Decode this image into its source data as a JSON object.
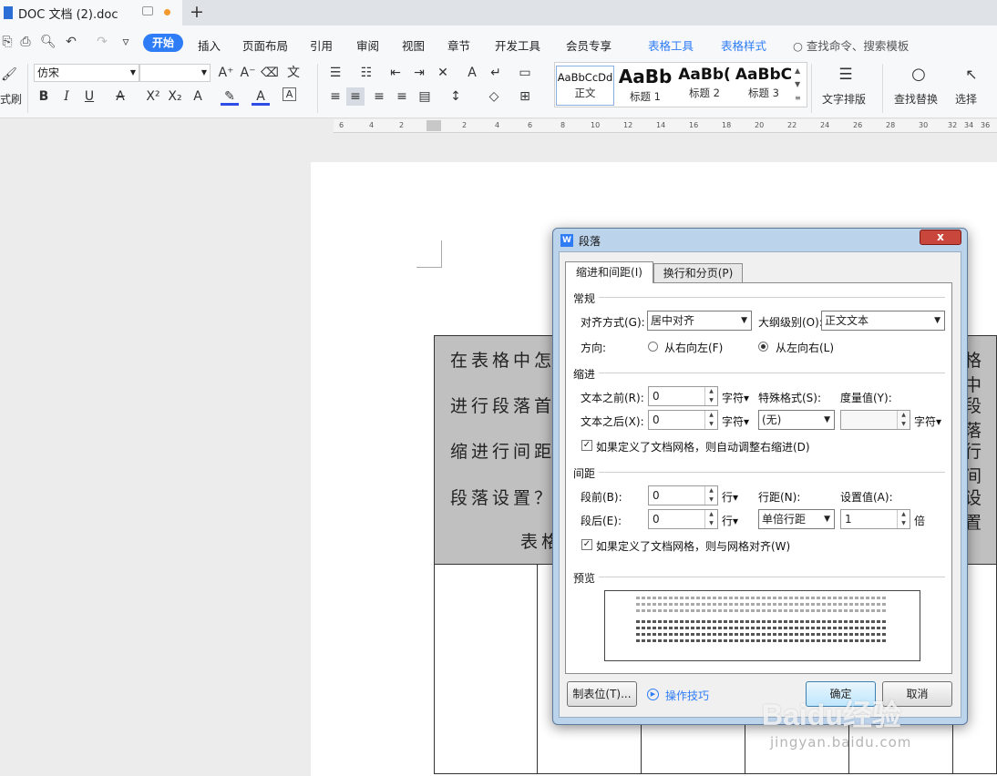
{
  "tab": {
    "title": "DOC 文档 (2).doc",
    "prefix": "E"
  },
  "menu": {
    "start": "开始",
    "insert": "插入",
    "layout": "页面布局",
    "references": "引用",
    "review": "审阅",
    "view": "视图",
    "chapter": "章节",
    "developer": "开发工具",
    "member": "会员专享",
    "table_tools": "表格工具",
    "table_style": "表格样式",
    "search_placeholder": "查找命令、搜索模板"
  },
  "ribbon": {
    "format_painter": "式刷",
    "font_name": "仿宋",
    "font_size": "",
    "styles": [
      {
        "sample": "AaBbCcDd",
        "label": "正文"
      },
      {
        "sample": "AaBb",
        "label": "标题 1"
      },
      {
        "sample": "AaBb(",
        "label": "标题 2"
      },
      {
        "sample": "AaBbC",
        "label": "标题 3"
      }
    ],
    "text_layout": "文字排版",
    "find_replace": "查找替换",
    "select": "选择"
  },
  "ruler": {
    "numbers": [
      "6",
      "4",
      "2",
      "2",
      "4",
      "6",
      "8",
      "10",
      "12",
      "14",
      "16",
      "18",
      "20",
      "22",
      "24",
      "26",
      "28",
      "30",
      "32",
      "34",
      "36"
    ]
  },
  "document": {
    "lines_left": [
      "在表格中怎",
      "进行段落首",
      "缩进行间距",
      "段落设置？",
      "表格"
    ],
    "lines_right": [
      "格中",
      "段落",
      "行间",
      "设置"
    ]
  },
  "dialog": {
    "title": "段落",
    "close": "x",
    "tabs": {
      "indent": "缩进和间距(I)",
      "break": "换行和分页(P)"
    },
    "general": {
      "section": "常规",
      "align_label": "对齐方式(G):",
      "align_value": "居中对齐",
      "outline_label": "大纲级别(O):",
      "outline_value": "正文文本",
      "direction_label": "方向:",
      "rtl": "从右向左(F)",
      "ltr": "从左向右(L)"
    },
    "indent": {
      "section": "缩进",
      "before_label": "文本之前(R):",
      "before_value": "0",
      "after_label": "文本之后(X):",
      "after_value": "0",
      "unit": "字符▾",
      "special_label": "特殊格式(S):",
      "special_value": "(无)",
      "measure_label": "度量值(Y):",
      "measure_value": "",
      "measure_unit": "字符▾",
      "auto_adjust": "如果定义了文档网格，则自动调整右缩进(D)"
    },
    "spacing": {
      "section": "间距",
      "before_label": "段前(B):",
      "before_value": "0",
      "after_label": "段后(E):",
      "after_value": "0",
      "unit": "行▾",
      "line_label": "行距(N):",
      "line_value": "单倍行距",
      "setting_label": "设置值(A):",
      "setting_value": "1",
      "setting_unit": "倍",
      "snap_grid": "如果定义了文档网格，则与网格对齐(W)"
    },
    "preview_section": "预览",
    "tab_stops": "制表位(T)...",
    "tips": "操作技巧",
    "ok": "确定",
    "cancel": "取消"
  },
  "watermark": {
    "logo": "Baidu经验",
    "url": "jingyan.baidu.com"
  }
}
